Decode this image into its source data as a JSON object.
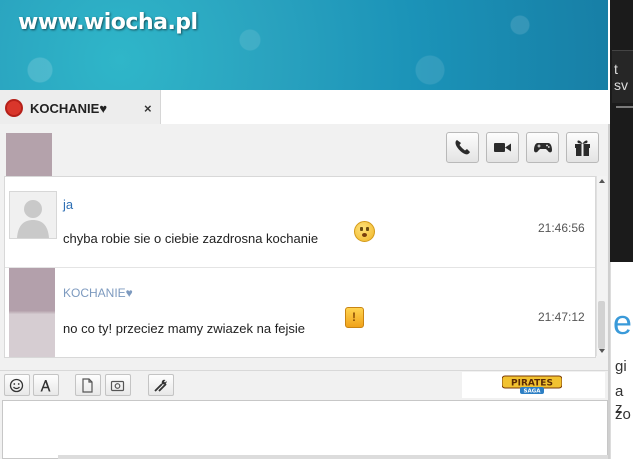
{
  "banner": {
    "watermark": "www.wiocha.pl"
  },
  "right_panel": {
    "partial_text": "t sv",
    "heading_fragment": "e",
    "lines": [
      "gi",
      "a z",
      "zo"
    ]
  },
  "chat_tab": {
    "title": "KOCHANIE♥",
    "close_label": "×",
    "status_color": "#d9362b"
  },
  "actions": {
    "call": "phone-icon",
    "video": "video-camera-icon",
    "games": "gamepad-icon",
    "gift": "gift-icon"
  },
  "messages": [
    {
      "sender": "ja",
      "text": "chyba robie sie o ciebie zazdrosna kochanie",
      "time": "21:46:56",
      "emoticon": "worried-face"
    },
    {
      "sender": "KOCHANIE♥",
      "text": "no co ty! przeciez mamy zwiazek na fejsie",
      "time": "21:47:12",
      "emoticon": "exclamation-box"
    }
  ],
  "emoticon_box_label": "!",
  "composer_toolbar": {
    "buttons": [
      "smiley-icon",
      "font-icon",
      "file-icon",
      "photo-icon",
      "tools-icon"
    ],
    "ad": {
      "title": "PIRATES",
      "subtitle": "SAGA"
    }
  },
  "composer": {
    "value": ""
  },
  "colors": {
    "link_blue": "#2e6fb4",
    "sender_blue": "#7d9abf",
    "banner_teal": "#1b93b8"
  }
}
